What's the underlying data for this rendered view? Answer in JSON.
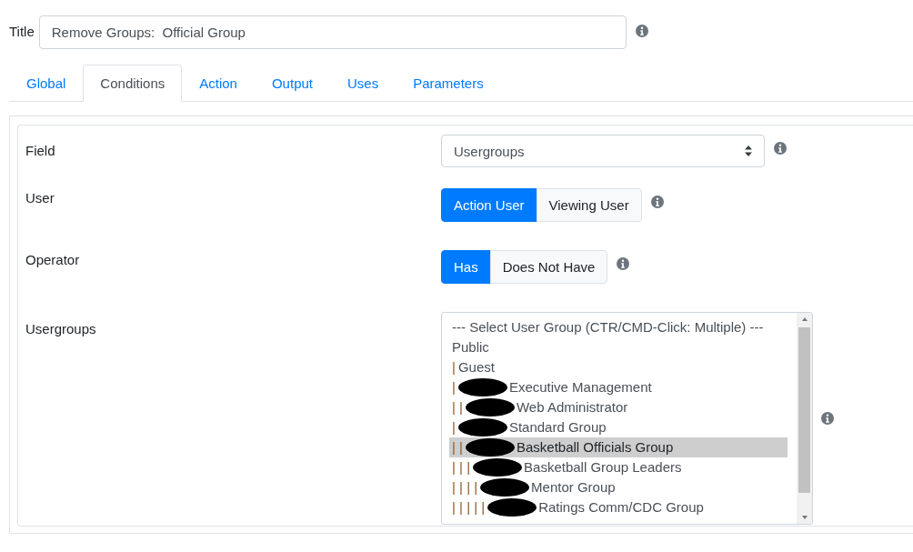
{
  "title_field": {
    "label": "Title",
    "value": "Remove Groups:  Official Group"
  },
  "tabs": [
    {
      "label": "Global",
      "selected": false
    },
    {
      "label": "Conditions",
      "selected": true
    },
    {
      "label": "Action",
      "selected": false
    },
    {
      "label": "Output",
      "selected": false
    },
    {
      "label": "Uses",
      "selected": false
    },
    {
      "label": "Parameters",
      "selected": false
    }
  ],
  "field": {
    "label": "Field",
    "value": "Usergroups"
  },
  "user": {
    "label": "User",
    "options": [
      {
        "label": "Action User",
        "selected": true
      },
      {
        "label": "Viewing User",
        "selected": false
      }
    ]
  },
  "operator": {
    "label": "Operator",
    "options": [
      {
        "label": "Has",
        "selected": true
      },
      {
        "label": "Does Not Have",
        "selected": false
      }
    ]
  },
  "usergroups": {
    "label": "Usergroups",
    "options": [
      {
        "redacted": false,
        "label": "--- Select User Group (CTR/CMD-Click: Multiple) ---",
        "selected": false
      },
      {
        "redacted": false,
        "label": "Public",
        "selected": false
      },
      {
        "prefix": "|",
        "redacted": false,
        "label": "Guest",
        "selected": false
      },
      {
        "prefix": "|",
        "redacted": true,
        "label": "Executive Management",
        "selected": false
      },
      {
        "prefix": "| |",
        "redacted": true,
        "label": "Web Administrator",
        "selected": false
      },
      {
        "prefix": "|",
        "redacted": true,
        "label": "Standard Group",
        "selected": false
      },
      {
        "prefix": "| |",
        "redacted": true,
        "label": "Basketball Officials Group",
        "selected": true
      },
      {
        "prefix": "| | |",
        "redacted": true,
        "label": "Basketball Group Leaders",
        "selected": false
      },
      {
        "prefix": "| | | |",
        "redacted": true,
        "label": "Mentor Group",
        "selected": false
      },
      {
        "prefix": "| | | | |",
        "redacted": true,
        "label": "Ratings Comm/CDC Group",
        "selected": false
      }
    ]
  }
}
